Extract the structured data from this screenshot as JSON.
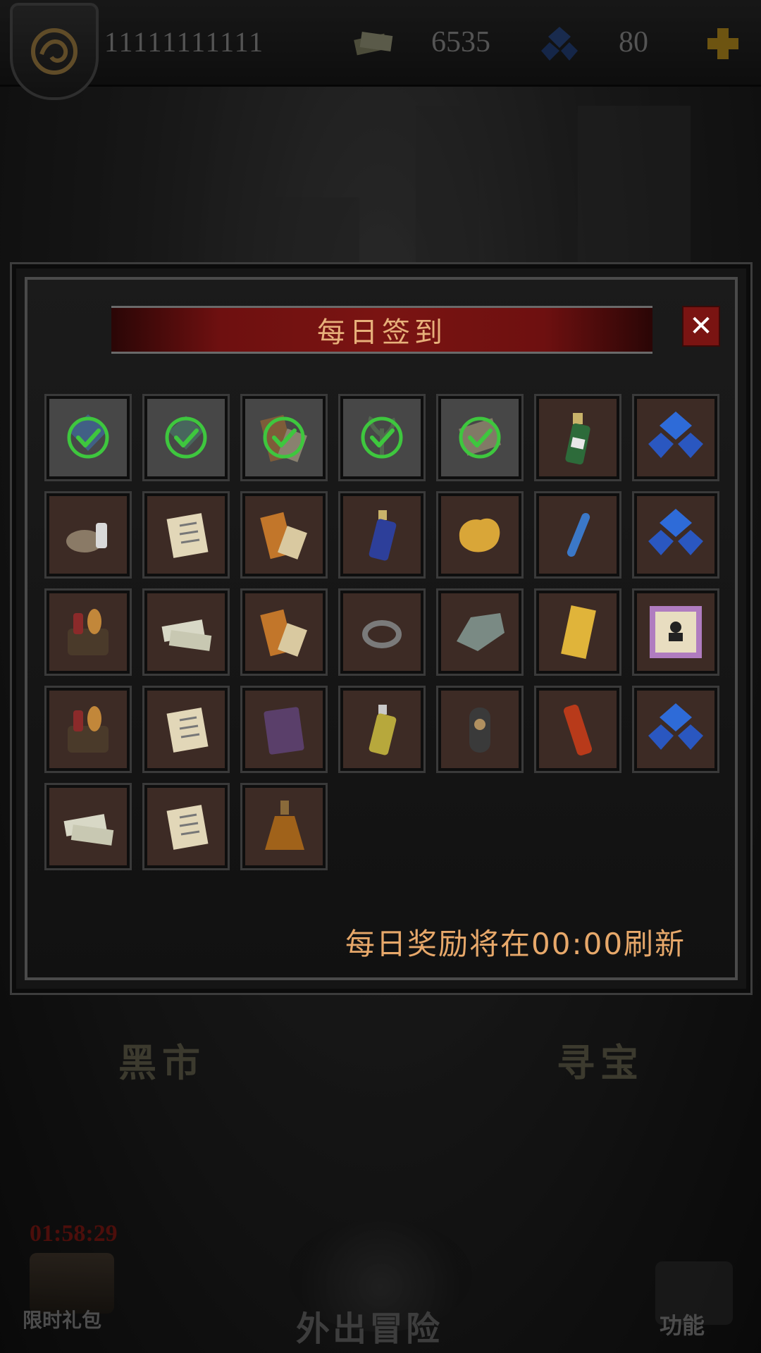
{
  "top_bar": {
    "player_id": "11111111111",
    "cash_icon": "cash-stack-icon",
    "cash_amount": "6535",
    "gem_icon": "blue-gem-icon",
    "gem_amount": "80",
    "add_icon": "plus-icon"
  },
  "background": {
    "tab_left": "黑市",
    "tab_right": "寻宝",
    "gift_timer": "01:58:29",
    "gift_label": "限时礼包",
    "adventure_label": "外出冒险",
    "function_label": "功能"
  },
  "dialog": {
    "title": "每日签到",
    "close_icon": "close-icon",
    "refresh_note": "每日奖励将在00:00刷新",
    "days": [
      {
        "item": "gem",
        "claimed": true
      },
      {
        "item": "gem-green",
        "claimed": true
      },
      {
        "item": "scroll-orange",
        "claimed": true
      },
      {
        "item": "plant",
        "claimed": true
      },
      {
        "item": "scroll",
        "claimed": true
      },
      {
        "item": "green-bottle",
        "claimed": false
      },
      {
        "item": "gems",
        "claimed": false
      },
      {
        "item": "supplies",
        "claimed": false
      },
      {
        "item": "scroll-paper",
        "claimed": false
      },
      {
        "item": "scroll-orange",
        "claimed": false
      },
      {
        "item": "blue-bottle",
        "claimed": false
      },
      {
        "item": "gold-nugget",
        "claimed": false
      },
      {
        "item": "test-tube",
        "claimed": false
      },
      {
        "item": "gems",
        "claimed": false
      },
      {
        "item": "food-bag",
        "claimed": false
      },
      {
        "item": "cash-stack",
        "claimed": false
      },
      {
        "item": "scroll-orange",
        "claimed": false
      },
      {
        "item": "ring",
        "claimed": false
      },
      {
        "item": "crystal-rock",
        "claimed": false
      },
      {
        "item": "talisman",
        "claimed": false
      },
      {
        "item": "recruit-card",
        "claimed": false
      },
      {
        "item": "food-bag",
        "claimed": false
      },
      {
        "item": "scroll-paper",
        "claimed": false
      },
      {
        "item": "book",
        "claimed": false
      },
      {
        "item": "yellow-bottle",
        "claimed": false
      },
      {
        "item": "idol",
        "claimed": false
      },
      {
        "item": "sos-flare",
        "claimed": false
      },
      {
        "item": "gems",
        "claimed": false
      },
      {
        "item": "cash-stack",
        "claimed": false
      },
      {
        "item": "scroll-paper",
        "claimed": false
      },
      {
        "item": "amber-flask",
        "claimed": false
      }
    ]
  },
  "colors": {
    "title_red": "#7a1412",
    "accent_orange": "#e7a86a",
    "check_green": "#3ec73e"
  }
}
